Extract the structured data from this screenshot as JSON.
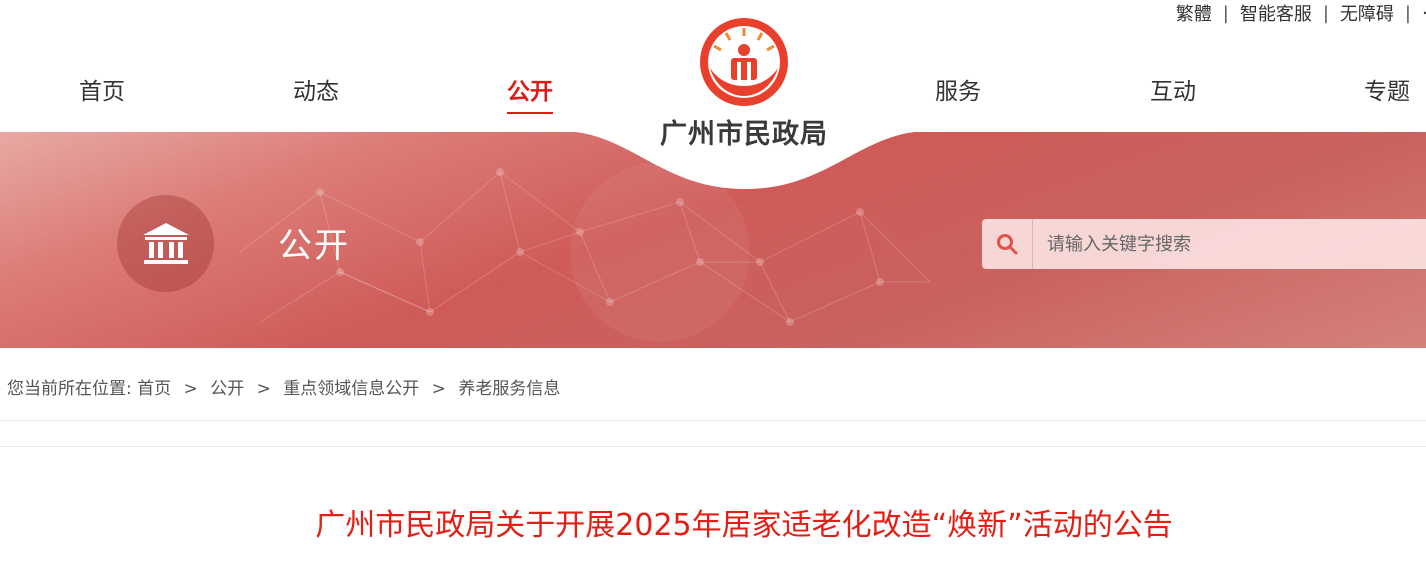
{
  "topbar": {
    "links": [
      "繁體",
      "智能客服",
      "无障碍"
    ]
  },
  "nav": {
    "items": [
      {
        "label": "首页"
      },
      {
        "label": "动态"
      },
      {
        "label": "公开",
        "active": true
      },
      {
        "label": "服务"
      },
      {
        "label": "互动"
      },
      {
        "label": "专题"
      }
    ]
  },
  "logo": {
    "text": "广州市民政局",
    "icon": "civil-affairs-emblem-icon"
  },
  "banner": {
    "title": "公开",
    "icon": "government-building-icon"
  },
  "search": {
    "placeholder": "请输入关键字搜索",
    "icon": "search-icon"
  },
  "breadcrumb": {
    "prefix": "您当前所在位置:",
    "items": [
      "首页",
      "公开",
      "重点领域信息公开",
      "养老服务信息"
    ]
  },
  "article": {
    "title": "广州市民政局关于开展2025年居家适老化改造“焕新”活动的公告"
  },
  "colors": {
    "accent": "#d91e18",
    "title_red": "#e31e14",
    "banner_red": "#cf5b58"
  }
}
